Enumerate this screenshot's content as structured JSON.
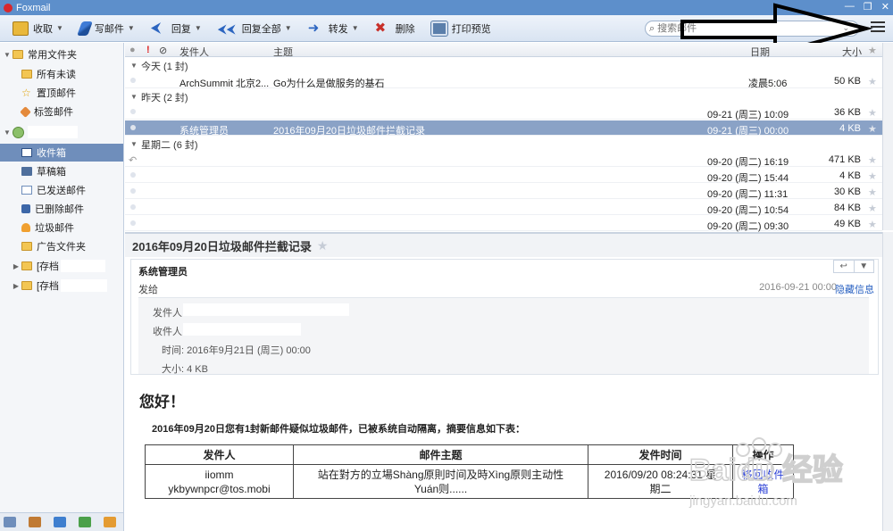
{
  "app": {
    "title": "Foxmail"
  },
  "toolbar": {
    "receive": "收取",
    "compose": "写邮件",
    "reply": "回复",
    "reply_all": "回复全部",
    "forward": "转发",
    "delete": "删除",
    "print_preview": "打印预览"
  },
  "search": {
    "placeholder": "搜索邮件"
  },
  "sidebar": {
    "common_folder": "常用文件夹",
    "common_items": [
      "所有未读",
      "置顶邮件",
      "标签邮件"
    ],
    "account_items": [
      "收件箱",
      "草稿箱",
      "已发送邮件",
      "已删除邮件",
      "垃圾邮件",
      "广告文件夹"
    ],
    "archive_items": [
      "[存档",
      "[存档"
    ]
  },
  "list": {
    "columns": {
      "sender": "发件人",
      "subject": "主题",
      "date": "日期",
      "size": "大小"
    },
    "groups": [
      {
        "label": "今天 (1 封)"
      },
      {
        "label": "昨天 (2 封)"
      },
      {
        "label": "星期二 (6 封)"
      }
    ],
    "rows": [
      {
        "sender": "ArchSummit 北京2...",
        "subject": "Go为什么是做服务的基石",
        "date": "凌晨5:06",
        "size": "50 KB"
      },
      {
        "sender": "",
        "subject": "",
        "date": "09-21 (周三) 10:09",
        "size": "36 KB"
      },
      {
        "sender": "系统管理员",
        "subject": "2016年09月20日垃圾邮件拦截记录",
        "date": "09-21 (周三) 00:00",
        "size": "4 KB"
      },
      {
        "sender": "",
        "subject": "",
        "date": "09-20 (周二) 16:19",
        "size": "471 KB"
      },
      {
        "sender": "",
        "subject": "",
        "date": "09-20 (周二) 15:44",
        "size": "4 KB"
      },
      {
        "sender": "",
        "subject": "",
        "date": "09-20 (周二) 11:31",
        "size": "30 KB"
      },
      {
        "sender": "",
        "subject": "",
        "date": "09-20 (周二) 10:54",
        "size": "84 KB"
      },
      {
        "sender": "",
        "subject": "",
        "date": "09-20 (周二) 09:30",
        "size": "49 KB"
      }
    ]
  },
  "reader": {
    "subject": "2016年09月20日垃圾邮件拦截记录",
    "sender": "系统管理员",
    "send_to": "发给",
    "date": "2016-09-21 00:00",
    "hide_info": "隐藏信息",
    "from_label": "发件人:",
    "to_label": "收件人:",
    "time_line": "时间: 2016年9月21日 (周三) 00:00",
    "size_line": "大小: 4 KB",
    "greeting": "您好！",
    "notice": "2016年09月20日您有1封新邮件疑似垃圾邮件，已被系统自动隔离，摘要信息如下表：",
    "table": {
      "headers": [
        "发件人",
        "邮件主题",
        "发件时间",
        "操作"
      ],
      "row": {
        "sender_name": "iiomm",
        "sender_email": "ykbywnpcr@tos.mobi",
        "subject_line1": "站在對方的立場Shàng原則时间及時Xìng原则主动性",
        "subject_line2": "Yuán则......",
        "time": "2016/09/20 08:24:31 星",
        "weekday": "期二",
        "action_line1": "移回收件",
        "action_line2": "箱"
      }
    }
  },
  "watermark": {
    "text1": "Baidu 经验",
    "text2": "jingyan.baidu.com"
  }
}
